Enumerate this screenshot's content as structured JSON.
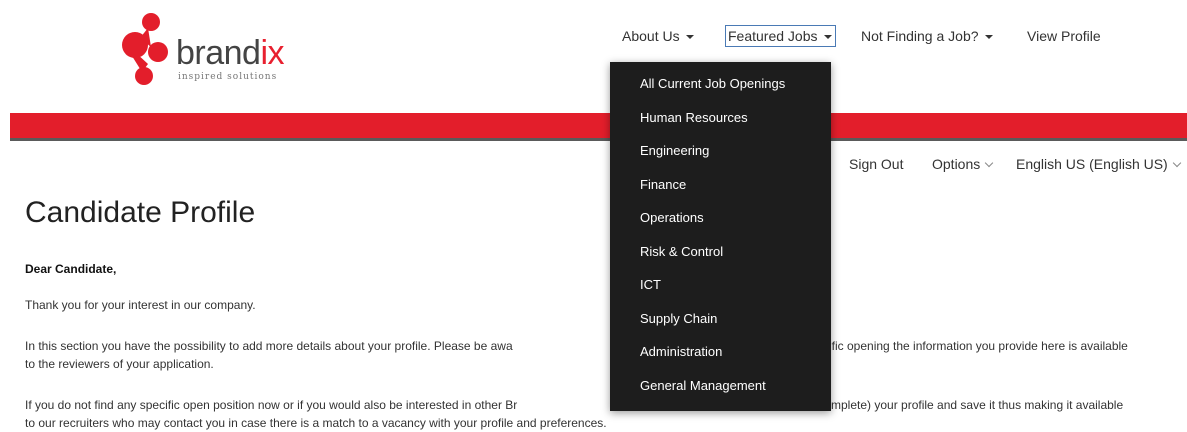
{
  "logo": {
    "name": "brand",
    "name_accent": "ix",
    "tagline": "inspired solutions"
  },
  "nav": {
    "about": "About Us",
    "featured": "Featured Jobs",
    "not_finding": "Not Finding a Job?",
    "view_profile": "View Profile"
  },
  "subnav": {
    "sign_out": "Sign Out",
    "options": "Options",
    "language": "English US (English US)"
  },
  "dropdown": {
    "items": [
      "All Current Job Openings",
      "Human Resources",
      "Engineering",
      "Finance",
      "Operations",
      "Risk & Control",
      "ICT",
      "Supply Chain",
      "Administration",
      "General Management"
    ]
  },
  "content": {
    "title": "Candidate Profile",
    "greeting": "Dear Candidate,",
    "p1": "Thank you for your interest in our company.",
    "p2_left": "In this section you have the possibility to add more details about your profile. Please be awa",
    "p2_right": "ific opening the information you provide here is available",
    "p2_line2": "to the reviewers of your application.",
    "p3_left": "If you do not find any specific open position now or if you would also be interested in other Br",
    "p3_right": "mplete) your profile and save it thus making it available",
    "p3_line2": "to our recruiters who may contact you in case there is a match to a vacancy with your profile and preferences."
  },
  "colors": {
    "brand_red": "#e31e2b",
    "dropdown_bg": "#1d1d1d",
    "nav_focus_border": "#4a7ab5"
  }
}
